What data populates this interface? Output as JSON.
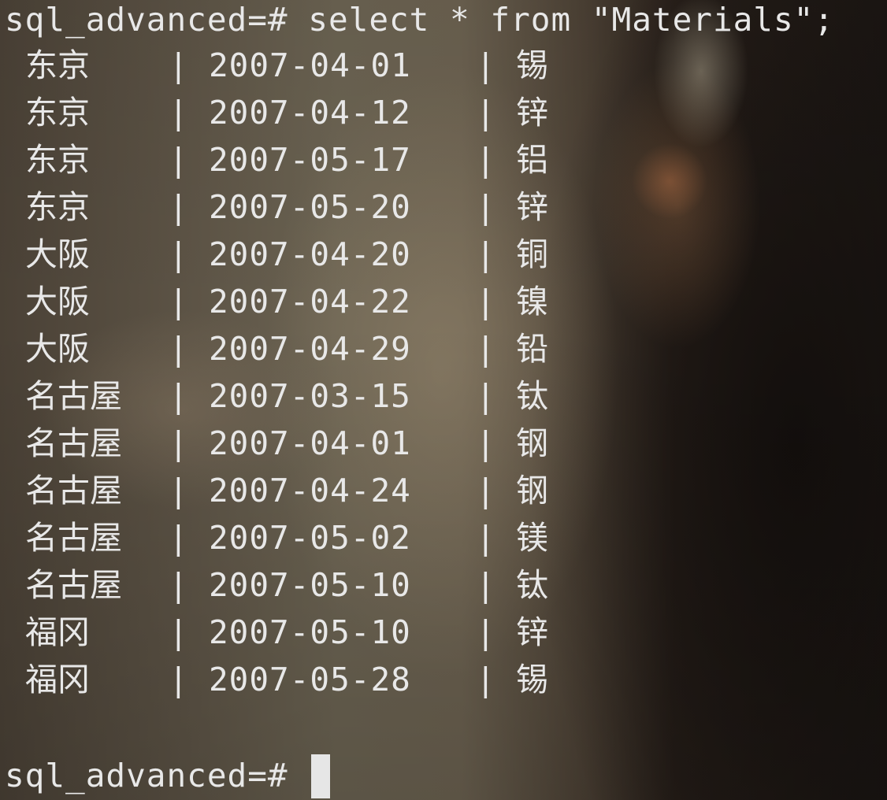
{
  "terminal": {
    "prompt": "sql_advanced=#",
    "command": " select * from \"Materials\";",
    "separator": "|",
    "rows": [
      {
        "city": "东京",
        "date": "2007-04-01",
        "material": "锡"
      },
      {
        "city": "东京",
        "date": "2007-04-12",
        "material": "锌"
      },
      {
        "city": "东京",
        "date": "2007-05-17",
        "material": "铝"
      },
      {
        "city": "东京",
        "date": "2007-05-20",
        "material": "锌"
      },
      {
        "city": "大阪",
        "date": "2007-04-20",
        "material": "铜"
      },
      {
        "city": "大阪",
        "date": "2007-04-22",
        "material": "镍"
      },
      {
        "city": "大阪",
        "date": "2007-04-29",
        "material": "铅"
      },
      {
        "city": "名古屋",
        "date": "2007-03-15",
        "material": "钛"
      },
      {
        "city": "名古屋",
        "date": "2007-04-01",
        "material": "钢"
      },
      {
        "city": "名古屋",
        "date": "2007-04-24",
        "material": "钢"
      },
      {
        "city": "名古屋",
        "date": "2007-05-02",
        "material": "镁"
      },
      {
        "city": "名古屋",
        "date": "2007-05-10",
        "material": "钛"
      },
      {
        "city": "福冈",
        "date": "2007-05-10",
        "material": "锌"
      },
      {
        "city": "福冈",
        "date": "2007-05-28",
        "material": "锡"
      }
    ],
    "second_prompt": "sql_advanced=#"
  },
  "colors": {
    "text": "#e8e8e8",
    "cursor": "#e6e6e6"
  }
}
